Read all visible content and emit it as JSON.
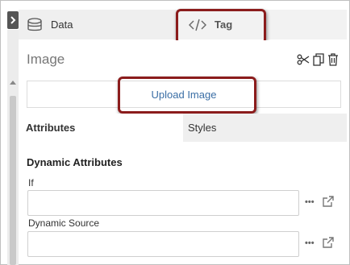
{
  "tabs": {
    "data_label": "Data",
    "tag_label": "Tag"
  },
  "panel": {
    "title": "Image",
    "icons": [
      "scissors-icon",
      "copy-icon",
      "trash-icon"
    ]
  },
  "upload": {
    "button_label": "Upload Image"
  },
  "subtabs": {
    "attributes_label": "Attributes",
    "styles_label": "Styles"
  },
  "dynamic_attributes": {
    "section_title": "Dynamic Attributes",
    "fields": [
      {
        "label": "If",
        "value": "",
        "more_label": "•••"
      },
      {
        "label": "Dynamic Source",
        "value": "",
        "more_label": "•••"
      }
    ]
  },
  "colors": {
    "callout_border": "#8b1c1c",
    "link_blue": "#3a6ea5",
    "tab_inactive_bg": "#efefef",
    "collapse_tab_bg": "#555555"
  }
}
